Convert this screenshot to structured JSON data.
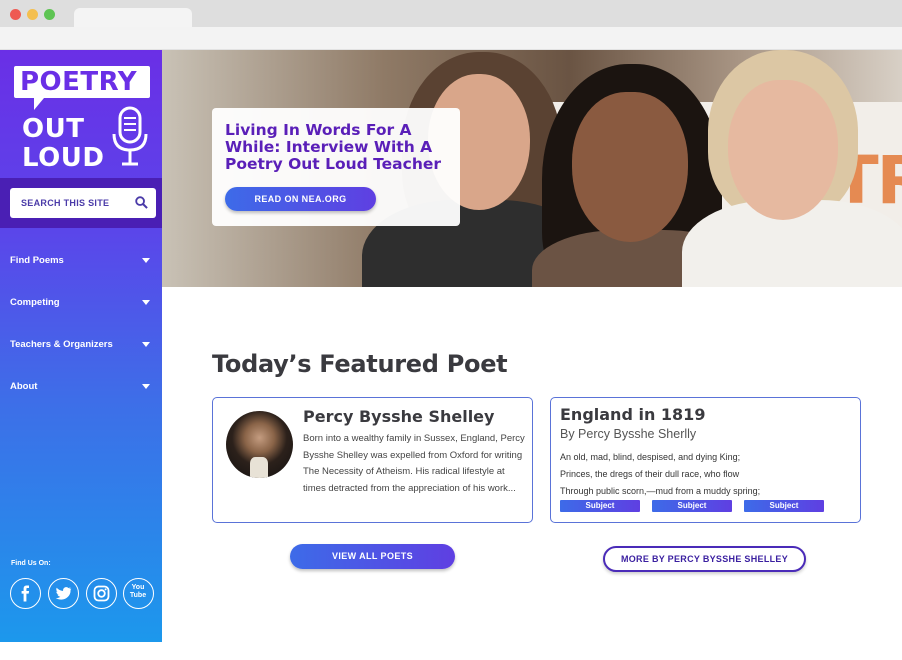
{
  "brand": {
    "logo_words": [
      "POETRY",
      "OUT",
      "LOUD"
    ],
    "colors": {
      "purple": "#6a2fe6",
      "blue": "#1c98ec",
      "heading": "#5a1fb8"
    }
  },
  "sidebar": {
    "search_placeholder": "SEARCH THIS SITE",
    "nav": [
      {
        "label": "Find Poems"
      },
      {
        "label": "Competing"
      },
      {
        "label": "Teachers & Organizers"
      },
      {
        "label": "About"
      }
    ],
    "find_us_label": "Find Us On:",
    "socials": [
      "facebook-icon",
      "twitter-icon",
      "instagram-icon",
      "youtube-icon"
    ],
    "youtube_text": "You Tube"
  },
  "hero": {
    "title": "Living In Words For A While: Interview With A Poetry Out Loud Teacher",
    "button_label": "READ ON NEA.ORG",
    "sign_text": "POETR"
  },
  "main": {
    "heading": "Today’s Featured Poet",
    "poet": {
      "name": "Percy Bysshe Shelley",
      "bio": "Born into a wealthy family in Sussex, England, Percy Bysshe Shelley was expelled from Oxford for writing The Necessity of Atheism. His radical lifestyle at times detracted from the appreciation of his work..."
    },
    "poem": {
      "title": "England in 1819",
      "author": "By Percy Bysshe Sherlly",
      "lines": [
        "An old, mad, blind, despised, and dying King;",
        "Princes, the dregs of their dull race, who flow",
        "Through public scorn,—mud from a muddy spring;"
      ],
      "tags": [
        "Subject",
        "Subject",
        "Subject"
      ]
    },
    "view_all_label": "VIEW ALL POETS",
    "more_by_label": "MORE BY PERCY BYSSHE SHELLEY"
  }
}
